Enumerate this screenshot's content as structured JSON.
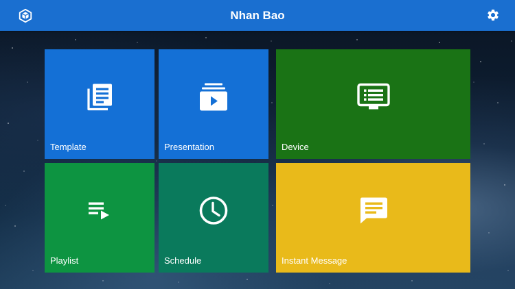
{
  "header": {
    "title": "Nhan Bao",
    "logo_icon": "cube-logo-icon",
    "settings_icon": "gear-icon",
    "background_color": "#1a6fd0"
  },
  "tiles": [
    {
      "label": "Template",
      "icon": "document-stack-icon",
      "color": "#1470d6"
    },
    {
      "label": "Presentation",
      "icon": "slides-play-icon",
      "color": "#1470d6"
    },
    {
      "label": "Device",
      "icon": "monitor-list-icon",
      "color": "#1a7315"
    },
    {
      "label": "Playlist",
      "icon": "playlist-icon",
      "color": "#0d9441"
    },
    {
      "label": "Schedule",
      "icon": "clock-icon",
      "color": "#0a7a5c"
    },
    {
      "label": "Instant Message",
      "icon": "message-bubble-icon",
      "color": "#e9ba1a"
    }
  ]
}
